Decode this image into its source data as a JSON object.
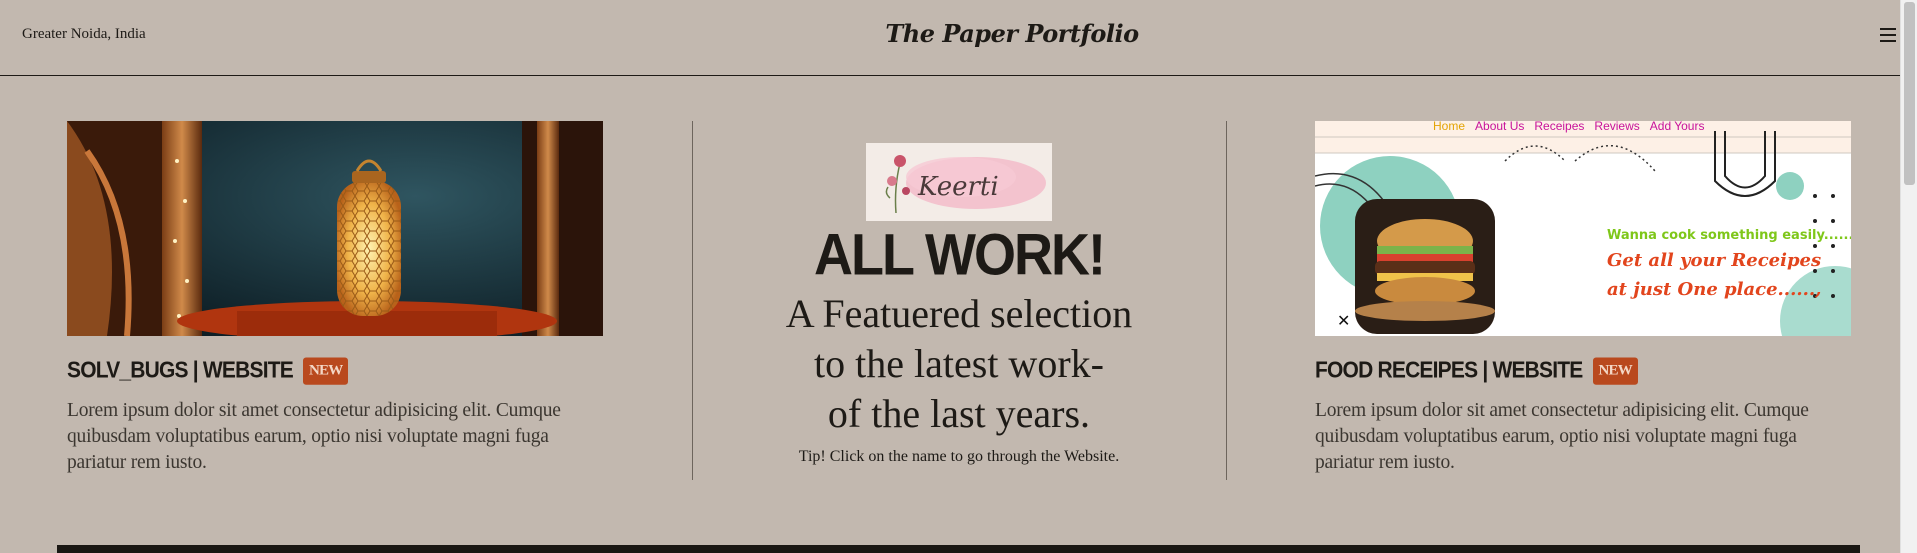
{
  "header": {
    "location": "Greater Noida, India",
    "brand": "The Paper Portfolio",
    "menu_icon": "hamburger-menu-icon"
  },
  "cards": [
    {
      "title": "Solv_bugs | Website",
      "badge": "NEW",
      "description": "Lorem ipsum dolor sit amet consectetur adipisicing elit. Cumque quibusdam voluptatibus earum, optio nisi voluptate magni fuga pariatur rem iusto."
    },
    {
      "title": "Food Receipes | Website",
      "badge": "NEW",
      "description": "Lorem ipsum dolor sit amet consectetur adipisicing elit. Cumque quibusdam voluptatibus earum, optio nisi voluptate magni fuga pariatur rem iusto.",
      "preview": {
        "nav": [
          "Home",
          "About Us",
          "Receipes",
          "Reviews",
          "Add Yours"
        ],
        "tagline": "Wanna cook something easily......?",
        "headline_1": "Get all your Receipes",
        "headline_2": "at just One place......,"
      }
    }
  ],
  "center": {
    "logo_text": "Keerti",
    "heading": "ALL WORK!",
    "subheading_line1": "A Featuered selection",
    "subheading_line2": "to the latest work-",
    "subheading_line3": "of the last years.",
    "tip": "Tip! Click on the name to go through the Website."
  },
  "colors": {
    "background": "#c2b8af",
    "text": "#1d1a16",
    "badge": "#b9491e"
  }
}
